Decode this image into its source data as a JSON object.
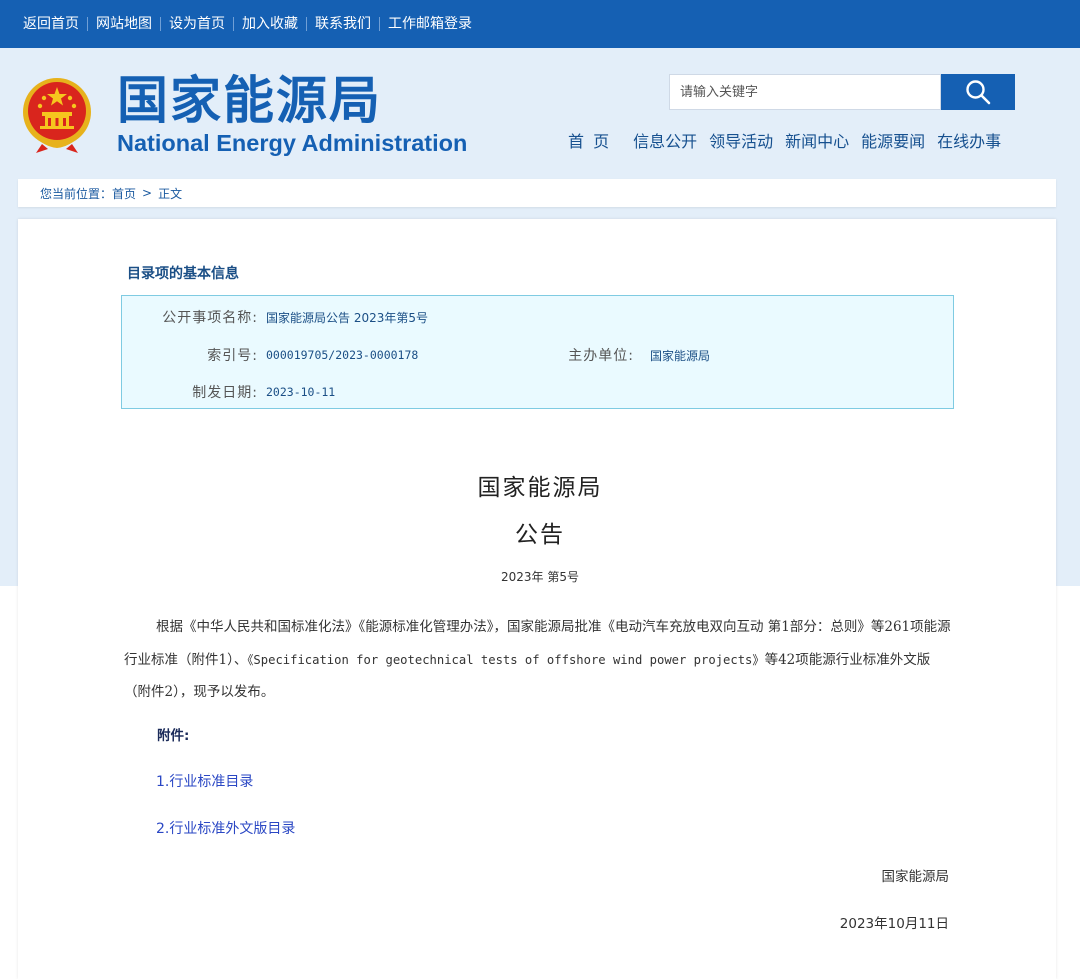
{
  "topbar": {
    "links": [
      "返回首页",
      "网站地图",
      "设为首页",
      "加入收藏",
      "联系我们",
      "工作邮箱登录"
    ]
  },
  "header": {
    "site_name_cn": "国家能源局",
    "site_name_en": "National Energy Administration",
    "search_placeholder": "请输入关键字",
    "nav": [
      "首 页",
      "信息公开",
      "领导活动",
      "新闻中心",
      "能源要闻",
      "在线办事"
    ]
  },
  "breadcrumb": {
    "prefix": "您当前位置：",
    "home": "首页",
    "arrow": ">",
    "current": "正文"
  },
  "info": {
    "heading": "目录项的基本信息",
    "item_label": "公开事项名称:",
    "item_value": "国家能源局公告 2023年第5号",
    "index_label": "索引号:",
    "index_value": "000019705/2023-0000178",
    "org_label": "主办单位:",
    "org_value": "国家能源局",
    "date_label": "制发日期:",
    "date_value": "2023-10-11"
  },
  "document": {
    "title_line1": "国家能源局",
    "title_line2": "公告",
    "number": "2023年  第5号",
    "body_part1": "根据《中华人民共和国标准化法》《能源标准化管理办法》，国家能源局批准《电动汽车充放电双向互动 第1部分：总则》等261项能源行业标准（附件1）、",
    "body_part2": "《Specification for geotechnical tests of offshore wind power projects》",
    "body_part3": "等42项能源行业标准外文版（附件2），现予以发布。",
    "attachments_label": "附件:",
    "attachment_1": "1.行业标准目录",
    "attachment_2": "2.行业标准外文版目录",
    "signature": "国家能源局",
    "date": "2023年10月11日"
  },
  "colors": {
    "brand_blue": "#1560b3",
    "header_bg": "#e3eef9",
    "info_box_bg": "#eafaff",
    "info_box_border": "#7fcbe2",
    "link_blue": "#2a47c4"
  }
}
